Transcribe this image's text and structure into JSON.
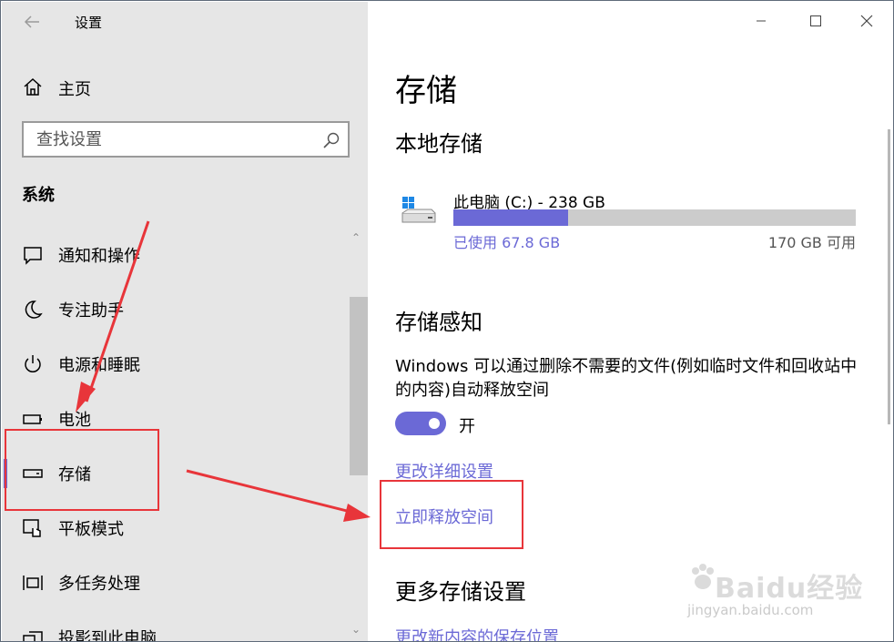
{
  "window": {
    "title": "设置"
  },
  "sidebar": {
    "home_label": "主页",
    "search_placeholder": "查找设置",
    "section_title": "系统",
    "items": [
      {
        "label": "通知和操作",
        "icon": "notification-icon"
      },
      {
        "label": "专注助手",
        "icon": "moon-icon"
      },
      {
        "label": "电源和睡眠",
        "icon": "power-icon"
      },
      {
        "label": "电池",
        "icon": "battery-icon"
      },
      {
        "label": "存储",
        "icon": "storage-icon",
        "selected": true
      },
      {
        "label": "平板模式",
        "icon": "tablet-mode-icon"
      },
      {
        "label": "多任务处理",
        "icon": "multitasking-icon"
      },
      {
        "label": "投影到此电脑",
        "icon": "project-icon"
      }
    ]
  },
  "main": {
    "title": "存储",
    "local_storage": {
      "heading": "本地存储",
      "drive_name": "此电脑 (C:) - 238 GB",
      "used_fraction": 0.285,
      "used_label": "已使用 67.8 GB",
      "free_label": "170 GB 可用"
    },
    "storage_sense": {
      "heading": "存储感知",
      "description": "Windows 可以通过删除不需要的文件(例如临时文件和回收站中的内容)自动释放空间",
      "toggle_state": "开",
      "toggle_on": true,
      "link_settings": "更改详细设置",
      "link_free_space": "立即释放空间"
    },
    "more_storage": {
      "heading": "更多存储设置",
      "link_save_location": "更改新内容的保存位置"
    }
  },
  "colors": {
    "accent": "#6b69d6",
    "sidebar_bg": "#e6e6e6",
    "annotation": "#e8353a"
  },
  "watermark": {
    "brand": "Baidu经验",
    "url": "jingyan.baidu.com"
  }
}
